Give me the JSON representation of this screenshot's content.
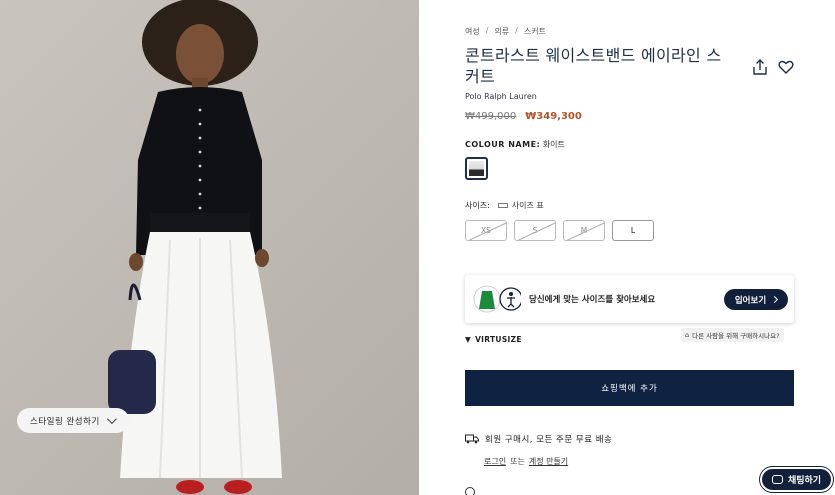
{
  "breadcrumb": [
    "여성",
    "의류",
    "스커트"
  ],
  "breadcrumb_sep": "/",
  "product": {
    "title": "콘트라스트 웨이스트밴드 에이라인 스커트",
    "brand": "Polo Ralph Lauren",
    "original_price": "₩499,000",
    "sale_price": "₩349,300"
  },
  "colour": {
    "label": "COLOUR NAME:",
    "value": "화이트"
  },
  "size": {
    "label": "사이즈:",
    "chart_label": "사이즈 표",
    "options": [
      {
        "label": "XS",
        "available": false
      },
      {
        "label": "S",
        "available": false
      },
      {
        "label": "M",
        "available": false
      },
      {
        "label": "L",
        "available": true
      }
    ]
  },
  "virtusize": {
    "prompt": "당신에게 맞는 사이즈를 찾아보세요",
    "button": "입어보기",
    "privacy": "다른 사람을 위해 구매하시나요?",
    "brand": "VIRTUSIZE"
  },
  "add_to_bag": "쇼핑백에 추가",
  "shipping": "회원 구매시, 모든 주문 무료 배송",
  "login": {
    "login_link": "로그인",
    "or": "또는",
    "signup_link": "계정 만들기"
  },
  "style_button": "스타일링 완성하기",
  "chat_button": "채팅하기",
  "colors": {
    "navy": "#0f2241",
    "sale": "#b4532a"
  }
}
